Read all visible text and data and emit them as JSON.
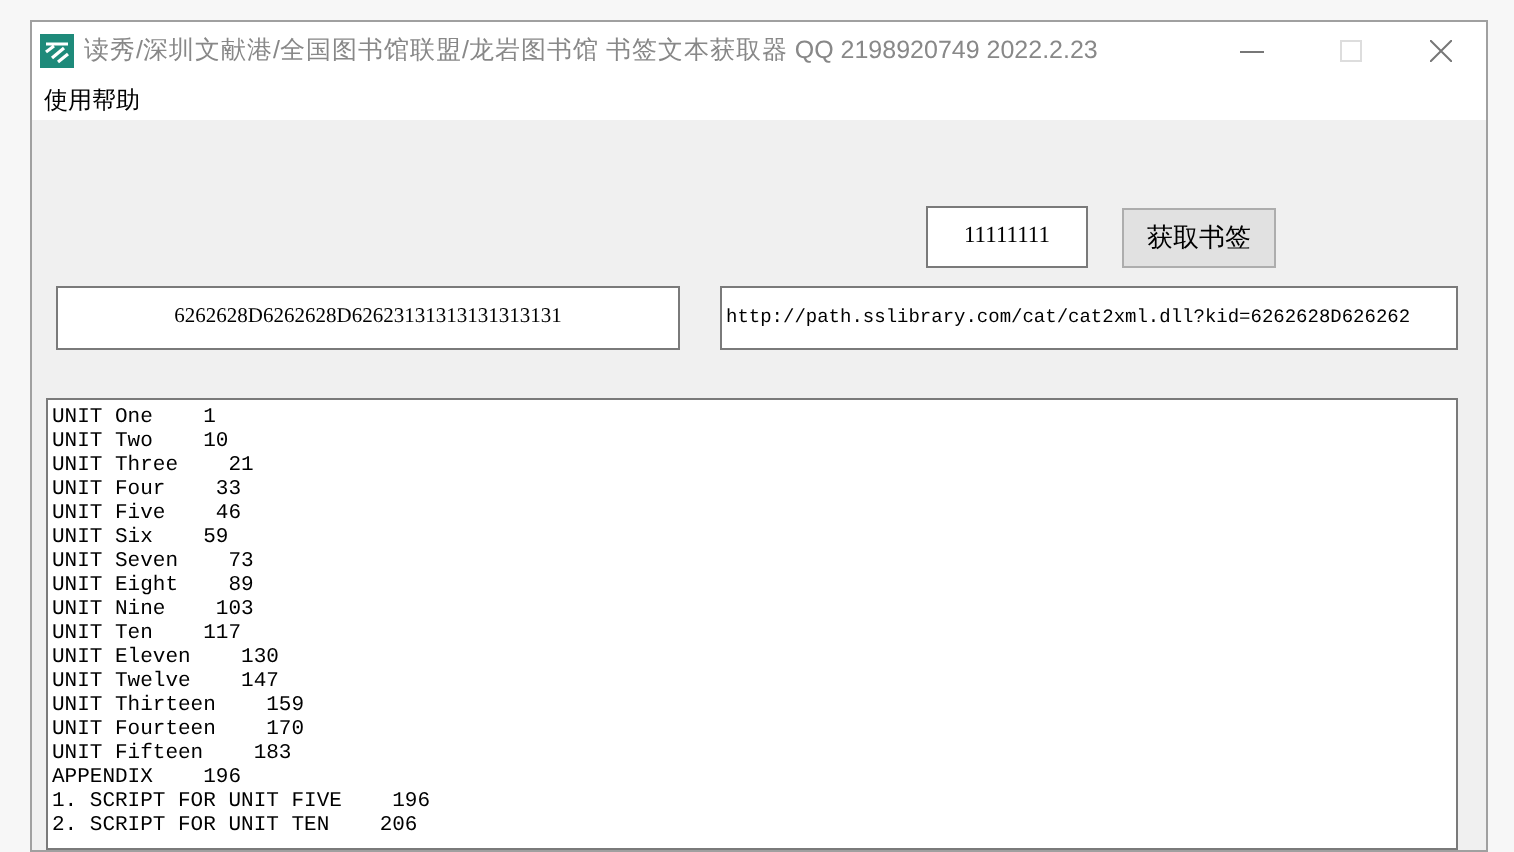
{
  "window": {
    "title": "读秀/深圳文献港/全国图书馆联盟/龙岩图书馆 书签文本获取器 QQ 2198920749 2022.2.23"
  },
  "menu": [
    "使用帮助"
  ],
  "id_field": {
    "value": "11111111"
  },
  "fetch_button": {
    "label": "获取书签"
  },
  "code_field": {
    "value": "6262628D6262628D62623131313131313131"
  },
  "url_field": {
    "value": "http://path.sslibrary.com/cat/cat2xml.dll?kid=6262628D626262"
  },
  "output_lines": [
    "UNIT One    1",
    "UNIT Two    10",
    "UNIT Three    21",
    "UNIT Four    33",
    "UNIT Five    46",
    "UNIT Six    59",
    "UNIT Seven    73",
    "UNIT Eight    89",
    "UNIT Nine    103",
    "UNIT Ten    117",
    "UNIT Eleven    130",
    "UNIT Twelve    147",
    "UNIT Thirteen    159",
    "UNIT Fourteen    170",
    "UNIT Fifteen    183",
    "APPENDIX    196",
    "1. SCRIPT FOR UNIT FIVE    196",
    "2. SCRIPT FOR UNIT TEN    206"
  ]
}
